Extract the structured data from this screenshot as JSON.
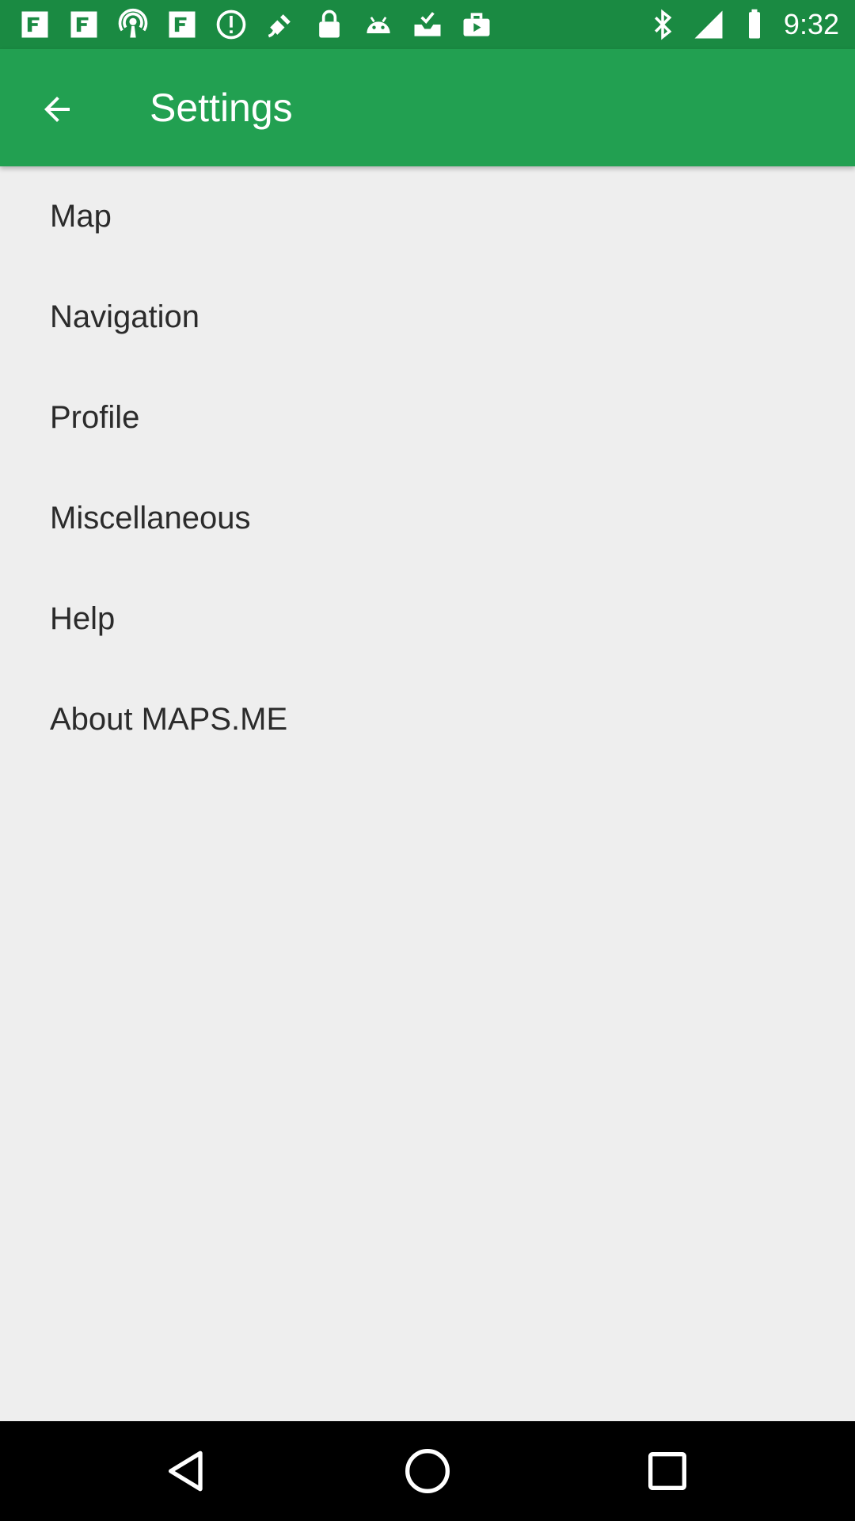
{
  "status_bar": {
    "time": "9:32",
    "icons": [
      "notification-icon",
      "notification-icon",
      "podcast-icon",
      "notification-icon",
      "alert-icon",
      "fake-gps-icon",
      "lock-icon",
      "android-icon",
      "inbox-check-icon",
      "briefcase-icon",
      "bluetooth-icon",
      "signal-icon",
      "battery-icon"
    ]
  },
  "toolbar": {
    "title": "Settings",
    "back_icon": "arrow-left-icon"
  },
  "settings": {
    "items": [
      {
        "label": "Map"
      },
      {
        "label": "Navigation"
      },
      {
        "label": "Profile"
      },
      {
        "label": "Miscellaneous"
      },
      {
        "label": "Help"
      },
      {
        "label": "About MAPS.ME"
      }
    ]
  },
  "nav_bar": {
    "icons": [
      "back-triangle-icon",
      "home-circle-icon",
      "recents-square-icon"
    ]
  },
  "colors": {
    "status_bar": "#1a8a42",
    "toolbar": "#22a051",
    "background": "#eeeeee",
    "text": "#2b2b2b"
  }
}
